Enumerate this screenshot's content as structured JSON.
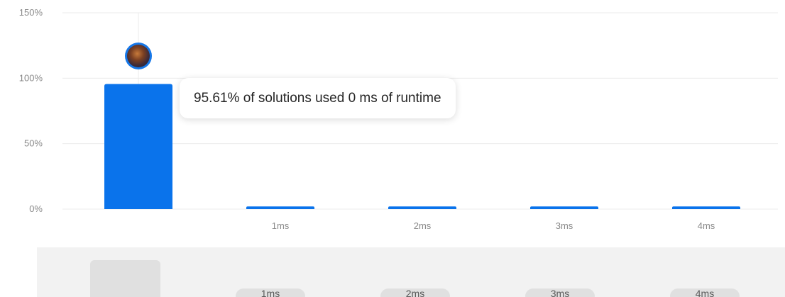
{
  "tooltip": {
    "text": "95.61% of solutions used 0 ms of runtime"
  },
  "colors": {
    "bar": "#0a73eb",
    "grid": "#ebebeb",
    "axis_text": "#8a8a8a",
    "brush_bg": "#f2f2f2",
    "brush_item": "#e0e0e0"
  },
  "chart_data": {
    "type": "bar",
    "categories": [
      "",
      "1ms",
      "2ms",
      "3ms",
      "4ms"
    ],
    "values": [
      95.61,
      2,
      2,
      2,
      2
    ],
    "yticks": [
      "0%",
      "50%",
      "100%",
      "150%"
    ],
    "ylim": [
      0,
      150
    ],
    "grid": true,
    "highlight_index": 0
  },
  "brush": {
    "labels": [
      "",
      "1ms",
      "2ms",
      "3ms",
      "4ms"
    ]
  }
}
